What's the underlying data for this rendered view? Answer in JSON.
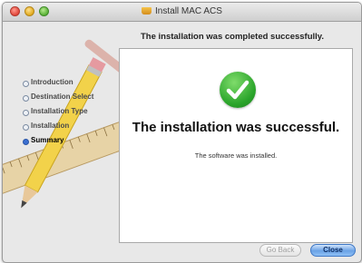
{
  "window": {
    "title": "Install MAC ACS",
    "header": "The installation was completed successfully."
  },
  "sidebar": {
    "steps": [
      {
        "label": "Introduction",
        "state": "completed"
      },
      {
        "label": "Destination Select",
        "state": "completed"
      },
      {
        "label": "Installation Type",
        "state": "completed"
      },
      {
        "label": "Installation",
        "state": "completed"
      },
      {
        "label": "Summary",
        "state": "current"
      }
    ]
  },
  "main": {
    "status_icon": "checkmark-icon",
    "success_title": "The installation was successful.",
    "success_message": "The software was installed."
  },
  "buttons": {
    "go_back": {
      "label": "Go Back",
      "enabled": false
    },
    "close": {
      "label": "Close",
      "enabled": true,
      "default": true
    }
  },
  "colors": {
    "success_green": "#2aa42a",
    "default_button_blue": "#6aa2e6",
    "current_step_dot": "#3b6fd1"
  }
}
